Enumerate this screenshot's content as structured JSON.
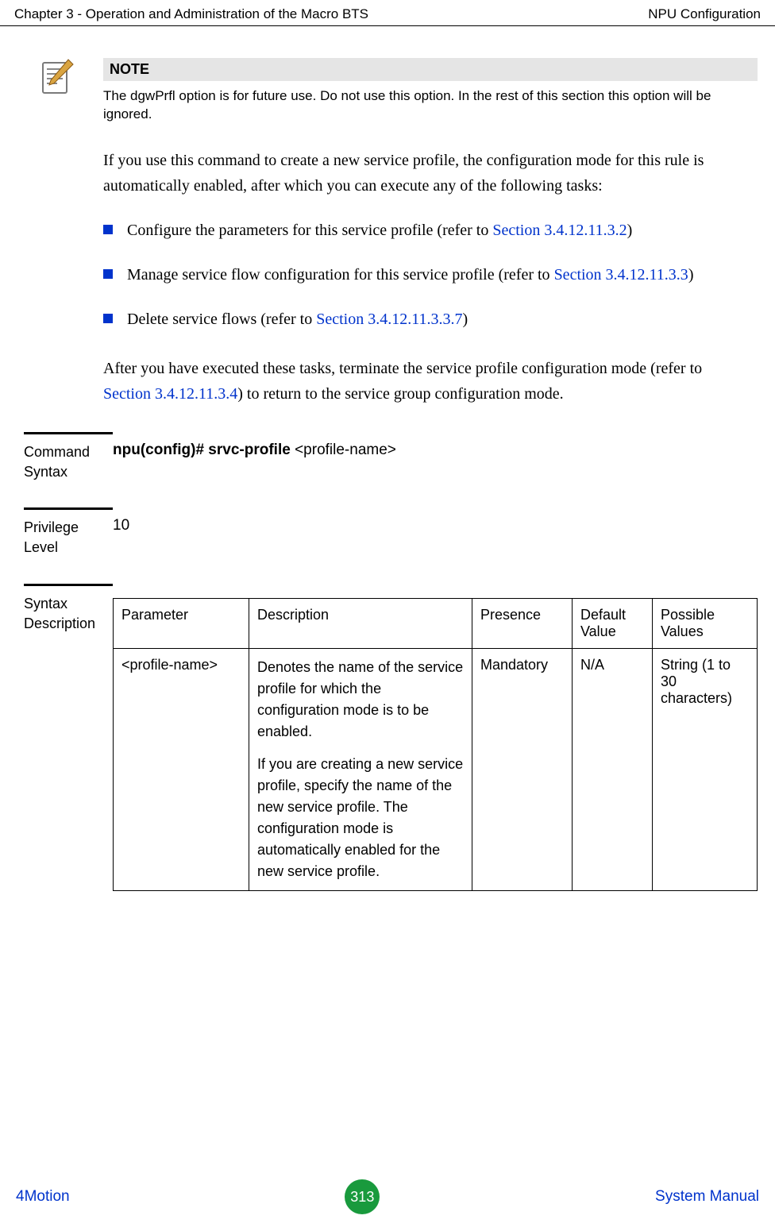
{
  "header": {
    "left": "Chapter 3 - Operation and Administration of the Macro BTS",
    "right": "NPU Configuration"
  },
  "note": {
    "title": "NOTE",
    "text": "The dgwPrfl option is for future use. Do not use this option. In the rest of this section this option will be ignored."
  },
  "intro_para": "If you use this command to create a new service profile, the configuration mode for this rule is automatically enabled, after which you can execute any of the following tasks:",
  "bullets": [
    {
      "pre": "Configure the parameters for this service profile (refer to ",
      "link": "Section 3.4.12.11.3.2",
      "post": ")"
    },
    {
      "pre": "Manage service flow configuration for this service profile (refer to ",
      "link": "Section 3.4.12.11.3.3",
      "post": ")"
    },
    {
      "pre": "Delete service flows (refer to ",
      "link": "Section 3.4.12.11.3.3.7",
      "post": ")"
    }
  ],
  "after_para": {
    "pre": "After you have executed these tasks, terminate the service profile configuration mode (refer to ",
    "link": "Section 3.4.12.11.3.4",
    "post": ") to return to the service group configuration mode."
  },
  "command_syntax": {
    "label": "Command Syntax",
    "bold": "npu(config)# srvc-profile ",
    "arg": "<profile-name>"
  },
  "privilege": {
    "label": "Privilege Level",
    "value": "10"
  },
  "syntax_desc": {
    "label": "Syntax Description",
    "columns": {
      "c1": "Parameter",
      "c2": "Description",
      "c3": "Presence",
      "c4": "Default Value",
      "c5": "Possible Values"
    },
    "row": {
      "param": "<profile-name>",
      "desc_p1": "Denotes the name of the service profile for which the configuration mode is to be enabled.",
      "desc_p2": "If you are creating a new service profile, specify the name of the new service profile. The configuration mode is automatically enabled for the new service profile.",
      "presence": "Mandatory",
      "default": "N/A",
      "possible": "String (1 to 30 characters)"
    }
  },
  "footer": {
    "left": "4Motion",
    "page": "313",
    "right": "System Manual"
  }
}
